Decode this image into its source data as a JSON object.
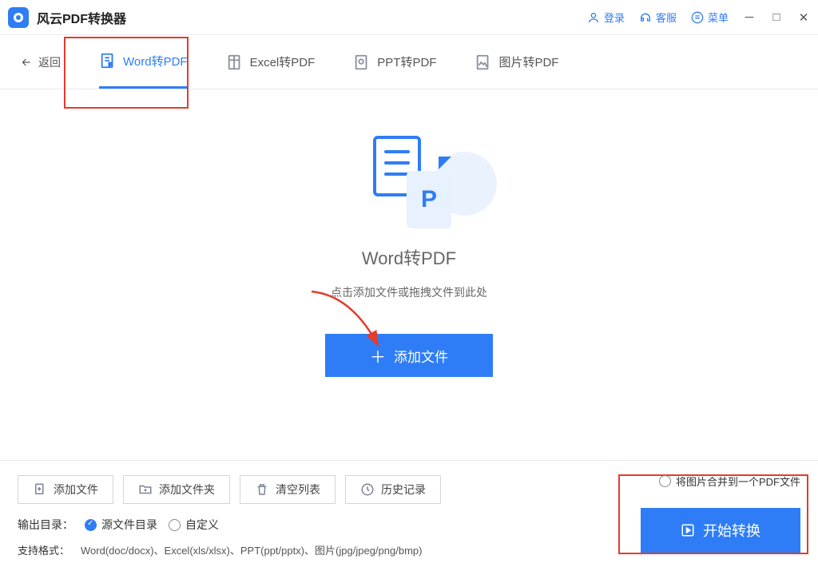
{
  "titlebar": {
    "app_name": "风云PDF转换器",
    "login": "登录",
    "support": "客服",
    "menu": "菜单"
  },
  "tabs": {
    "back": "返回",
    "items": [
      {
        "label": "Word转PDF",
        "active": true
      },
      {
        "label": "Excel转PDF",
        "active": false
      },
      {
        "label": "PPT转PDF",
        "active": false
      },
      {
        "label": "图片转PDF",
        "active": false
      }
    ]
  },
  "center": {
    "illus_letter": "P",
    "title": "Word转PDF",
    "subtitle": "点击添加文件或拖拽文件到此处",
    "add_button": "添加文件"
  },
  "bottom": {
    "buttons": {
      "add_file": "添加文件",
      "add_folder": "添加文件夹",
      "clear_list": "清空列表",
      "history": "历史记录"
    },
    "merge_option": "将图片合并到一个PDF文件",
    "output_label": "输出目录：",
    "output_options": {
      "source": "源文件目录",
      "custom": "自定义"
    },
    "format_label": "支持格式：",
    "format_value": "Word(doc/docx)、Excel(xls/xlsx)、PPT(ppt/pptx)、图片(jpg/jpeg/png/bmp)",
    "start": "开始转换"
  }
}
